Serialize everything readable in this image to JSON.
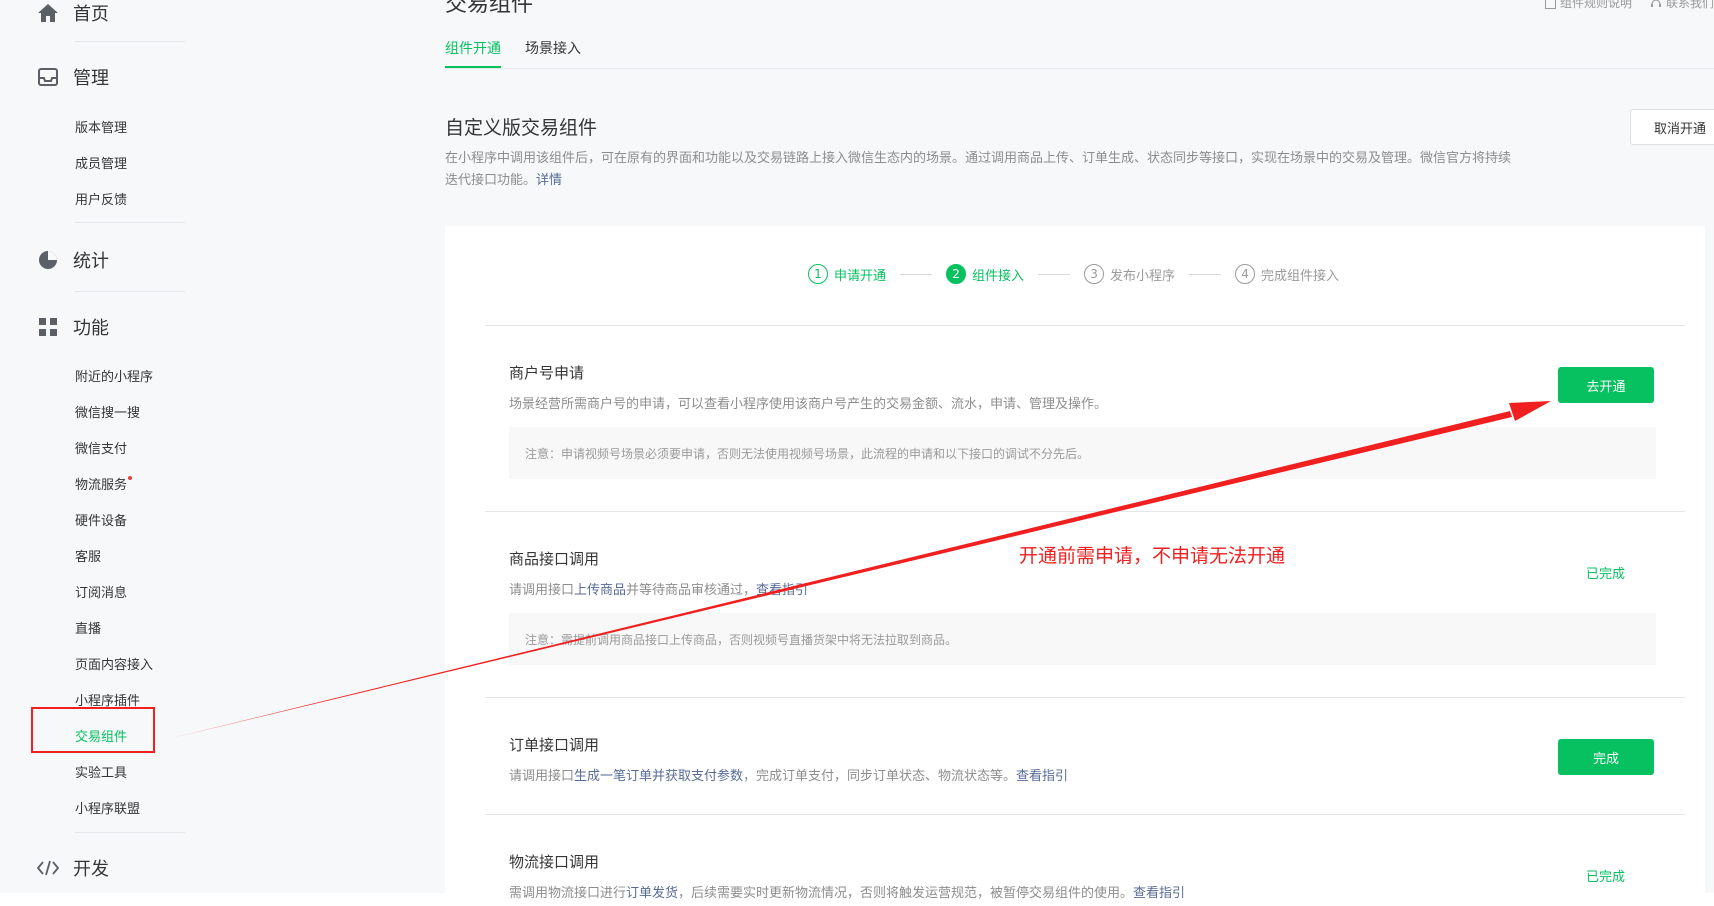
{
  "sidebar": {
    "home": "首页",
    "manage": "管理",
    "manage_items": [
      "版本管理",
      "成员管理",
      "用户反馈"
    ],
    "stats": "统计",
    "features": "功能",
    "feature_items": [
      "附近的小程序",
      "微信搜一搜",
      "微信支付",
      "物流服务",
      "硬件设备",
      "客服",
      "订阅消息",
      "直播",
      "页面内容接入",
      "小程序插件",
      "交易组件",
      "实验工具",
      "小程序联盟"
    ],
    "dev": "开发"
  },
  "header": {
    "page_title": "交易组件",
    "link_rules": "组件规则说明",
    "link_contact": "联系我们"
  },
  "tabs": [
    "组件开通",
    "场景接入"
  ],
  "section": {
    "title": "自定义版交易组件",
    "desc_text": "在小程序中调用该组件后，可在原有的界面和功能以及交易链路上接入微信生态内的场景。通过调用商品上传、订单生成、状态同步等接口，实现在场景中的交易及管理。微信官方将持续迭代接口功能。",
    "desc_link": "详情",
    "cancel_button": "取消开通"
  },
  "steps": [
    {
      "num": "1",
      "label": "申请开通",
      "state": "done"
    },
    {
      "num": "2",
      "label": "组件接入",
      "state": "active"
    },
    {
      "num": "3",
      "label": "发布小程序",
      "state": "todo"
    },
    {
      "num": "4",
      "label": "完成组件接入",
      "state": "todo"
    }
  ],
  "items": {
    "merchant": {
      "title": "商户号申请",
      "desc": "场景经营所需商户号的申请，可以查看小程序使用该商户号产生的交易金额、流水，申请、管理及操作。",
      "note": "注意：申请视频号场景必须要申请，否则无法使用视频号场景，此流程的申请和以下接口的调试不分先后。",
      "button": "去开通"
    },
    "product": {
      "title": "商品接口调用",
      "desc_pre": "请调用接口",
      "desc_link1": "上传商品",
      "desc_mid": "并等待商品审核通过，",
      "desc_link2": "查看指引",
      "note": "注意：需提前调用商品接口上传商品，否则视频号直播货架中将无法拉取到商品。",
      "status": "已完成"
    },
    "order": {
      "title": "订单接口调用",
      "desc_pre": "请调用接口",
      "desc_link1": "生成一笔订单并获取支付参数",
      "desc_mid": "，完成订单支付，同步订单状态、物流状态等。",
      "desc_link2": "查看指引",
      "button": "完成"
    },
    "logistics": {
      "title": "物流接口调用",
      "desc_pre": "需调用物流接口进行",
      "desc_link1": "订单发货",
      "desc_mid": "，后续需要实时更新物流情况，否则将触发运营规范，被暂停交易组件的使用。",
      "desc_link2": "查看指引",
      "status": "已完成"
    }
  },
  "annotation": {
    "text": "开通前需申请，不申请无法开通",
    "color": "#f02020"
  },
  "colors": {
    "accent": "#07c160",
    "link": "#576b95"
  }
}
